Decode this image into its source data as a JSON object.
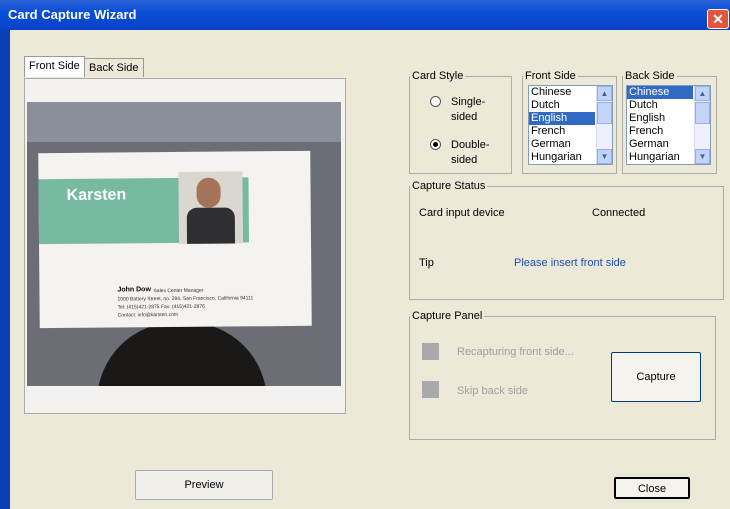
{
  "window": {
    "title": "Card Capture Wizard",
    "close_glyph": "✕"
  },
  "tabs": [
    {
      "label": "Front Side"
    },
    {
      "label": "Back Side"
    }
  ],
  "card_image": {
    "brand": "Karsten",
    "name": "John Dow",
    "name_title": "Sales Center Manager",
    "address": "1000 Battery Street, no. 284, San Francisco, California 94111",
    "phone": "Tel: (415)421-2875   Fax: (415)421-2876",
    "email": "Contact: info@karsten.com"
  },
  "card_style": {
    "legend": "Card Style",
    "options": [
      {
        "label_line1": "Single-",
        "label_line2": "sided",
        "selected": false
      },
      {
        "label_line1": "Double-",
        "label_line2": "sided",
        "selected": true
      }
    ]
  },
  "front_side": {
    "legend": "Front Side",
    "languages": [
      "Chinese",
      "Dutch",
      "English",
      "French",
      "German",
      "Hungarian"
    ],
    "selected": "English"
  },
  "back_side": {
    "legend": "Back Side",
    "languages": [
      "Chinese",
      "Dutch",
      "English",
      "French",
      "German",
      "Hungarian"
    ],
    "selected": "Chinese"
  },
  "capture_status": {
    "legend": "Capture Status",
    "device_label": "Card input device",
    "device_value": "Connected",
    "tip_label": "Tip",
    "tip_value": "Please insert front side",
    "tip_color": "#1f4ea8"
  },
  "capture_panel": {
    "legend": "Capture Panel",
    "recapture_label": "Recapturing front side...",
    "skip_label": "Skip back side",
    "capture_button": "Capture"
  },
  "footer": {
    "preview_button": "Preview",
    "close_button": "Close"
  },
  "colors": {
    "title_bar": "#0a4fd8",
    "selection": "#316ac5",
    "window_bg": "#ece9d8"
  }
}
